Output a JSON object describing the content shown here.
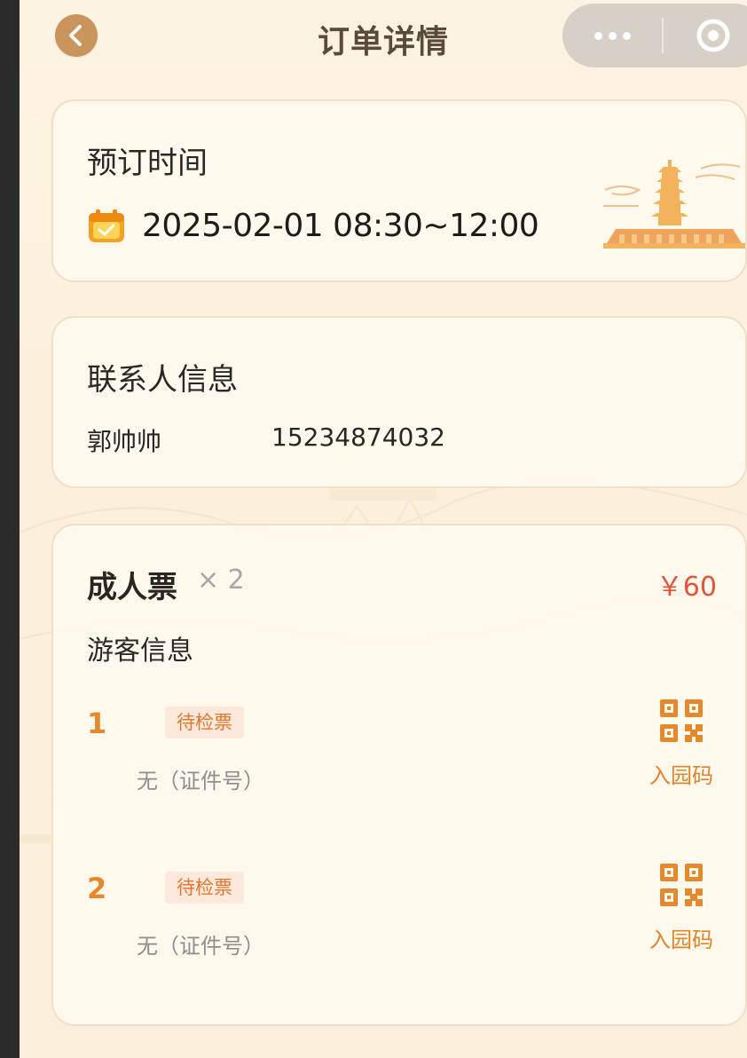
{
  "header": {
    "title": "订单详情",
    "back_icon": "chevron-left-icon",
    "more_icon": "more-dots-icon",
    "close_icon": "target-circle-icon"
  },
  "booking": {
    "section_title": "预订时间",
    "calendar_icon": "calendar-check-icon",
    "time": "2025-02-01 08:30~12:00",
    "decor_icon": "pagoda-illustration"
  },
  "contact": {
    "section_title": "联系人信息",
    "name": "郭帅帅",
    "phone": "15234874032"
  },
  "ticket": {
    "name": "成人票",
    "quantity": "× 2",
    "price": "￥60",
    "visitor_section_title": "游客信息",
    "visitors": [
      {
        "index": "1",
        "status": "待检票",
        "id_text": "无（证件号）",
        "qr_label": "入园码"
      },
      {
        "index": "2",
        "status": "待检票",
        "id_text": "无（证件号）",
        "qr_label": "入园码"
      }
    ]
  },
  "colors": {
    "accent_orange": "#e58a2c",
    "price_red": "#e2523c",
    "back_button": "#c9955c",
    "badge_bg": "#fde8dc",
    "page_bg": "#fdf3e2"
  }
}
